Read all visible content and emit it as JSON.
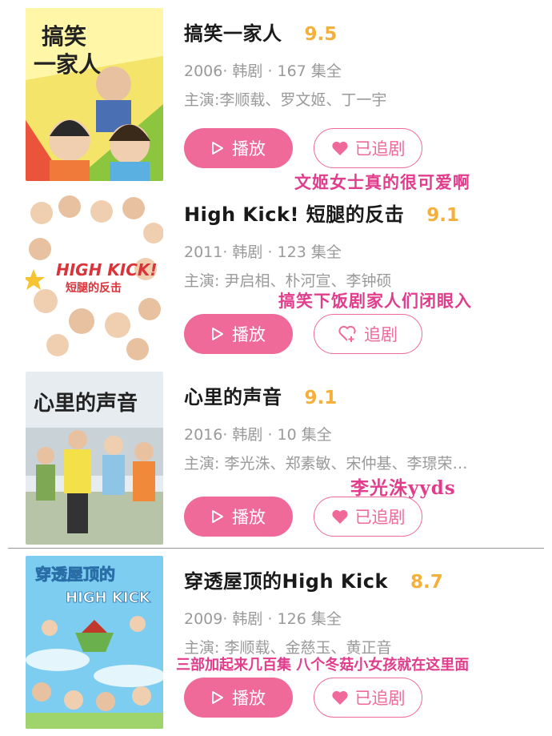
{
  "items": [
    {
      "title": "搞笑一家人",
      "rating": "9.5",
      "meta": "2006· 韩剧 · 167 集全",
      "cast": "主演:李顺载、罗文姬、丁一宇",
      "play_label": "播放",
      "follow_label": "已追剧",
      "followed": true,
      "note": "文姬女士真的很可爱啊",
      "poster_text": [
        "搞笑",
        "一家人"
      ]
    },
    {
      "title": "High Kick!  短腿的反击",
      "rating": "9.1",
      "meta": "2011· 韩剧 · 123 集全",
      "cast": "主演: 尹启相、朴河宣、李钟硕",
      "play_label": "播放",
      "follow_label": "追剧",
      "followed": false,
      "note": "搞笑下饭剧家人们闭眼入",
      "poster_text": [
        "HIGH KICK!",
        "短腿的反击"
      ]
    },
    {
      "title": "心里的声音",
      "rating": "9.1",
      "meta": "2016· 韩剧 · 10 集全",
      "cast": "主演: 李光洙、郑素敏、宋仲基、李璟荣…",
      "play_label": "播放",
      "follow_label": "已追剧",
      "followed": true,
      "note": "李光洙yyds",
      "poster_text": [
        "心里的声音"
      ]
    },
    {
      "title": "穿透屋顶的High Kick",
      "rating": "8.7",
      "meta": "2009· 韩剧 · 126 集全",
      "cast": "主演: 李顺载、金慈玉、黄正音",
      "play_label": "播放",
      "follow_label": "已追剧",
      "followed": true,
      "note": "三部加起来几百集 八个冬菇小女孩就在这里面",
      "poster_text": [
        "穿透屋顶的",
        "HIGH KICK"
      ]
    }
  ],
  "colors": {
    "accent": "#f06a99",
    "rating": "#f4b03a",
    "note": "#e23d8d"
  }
}
